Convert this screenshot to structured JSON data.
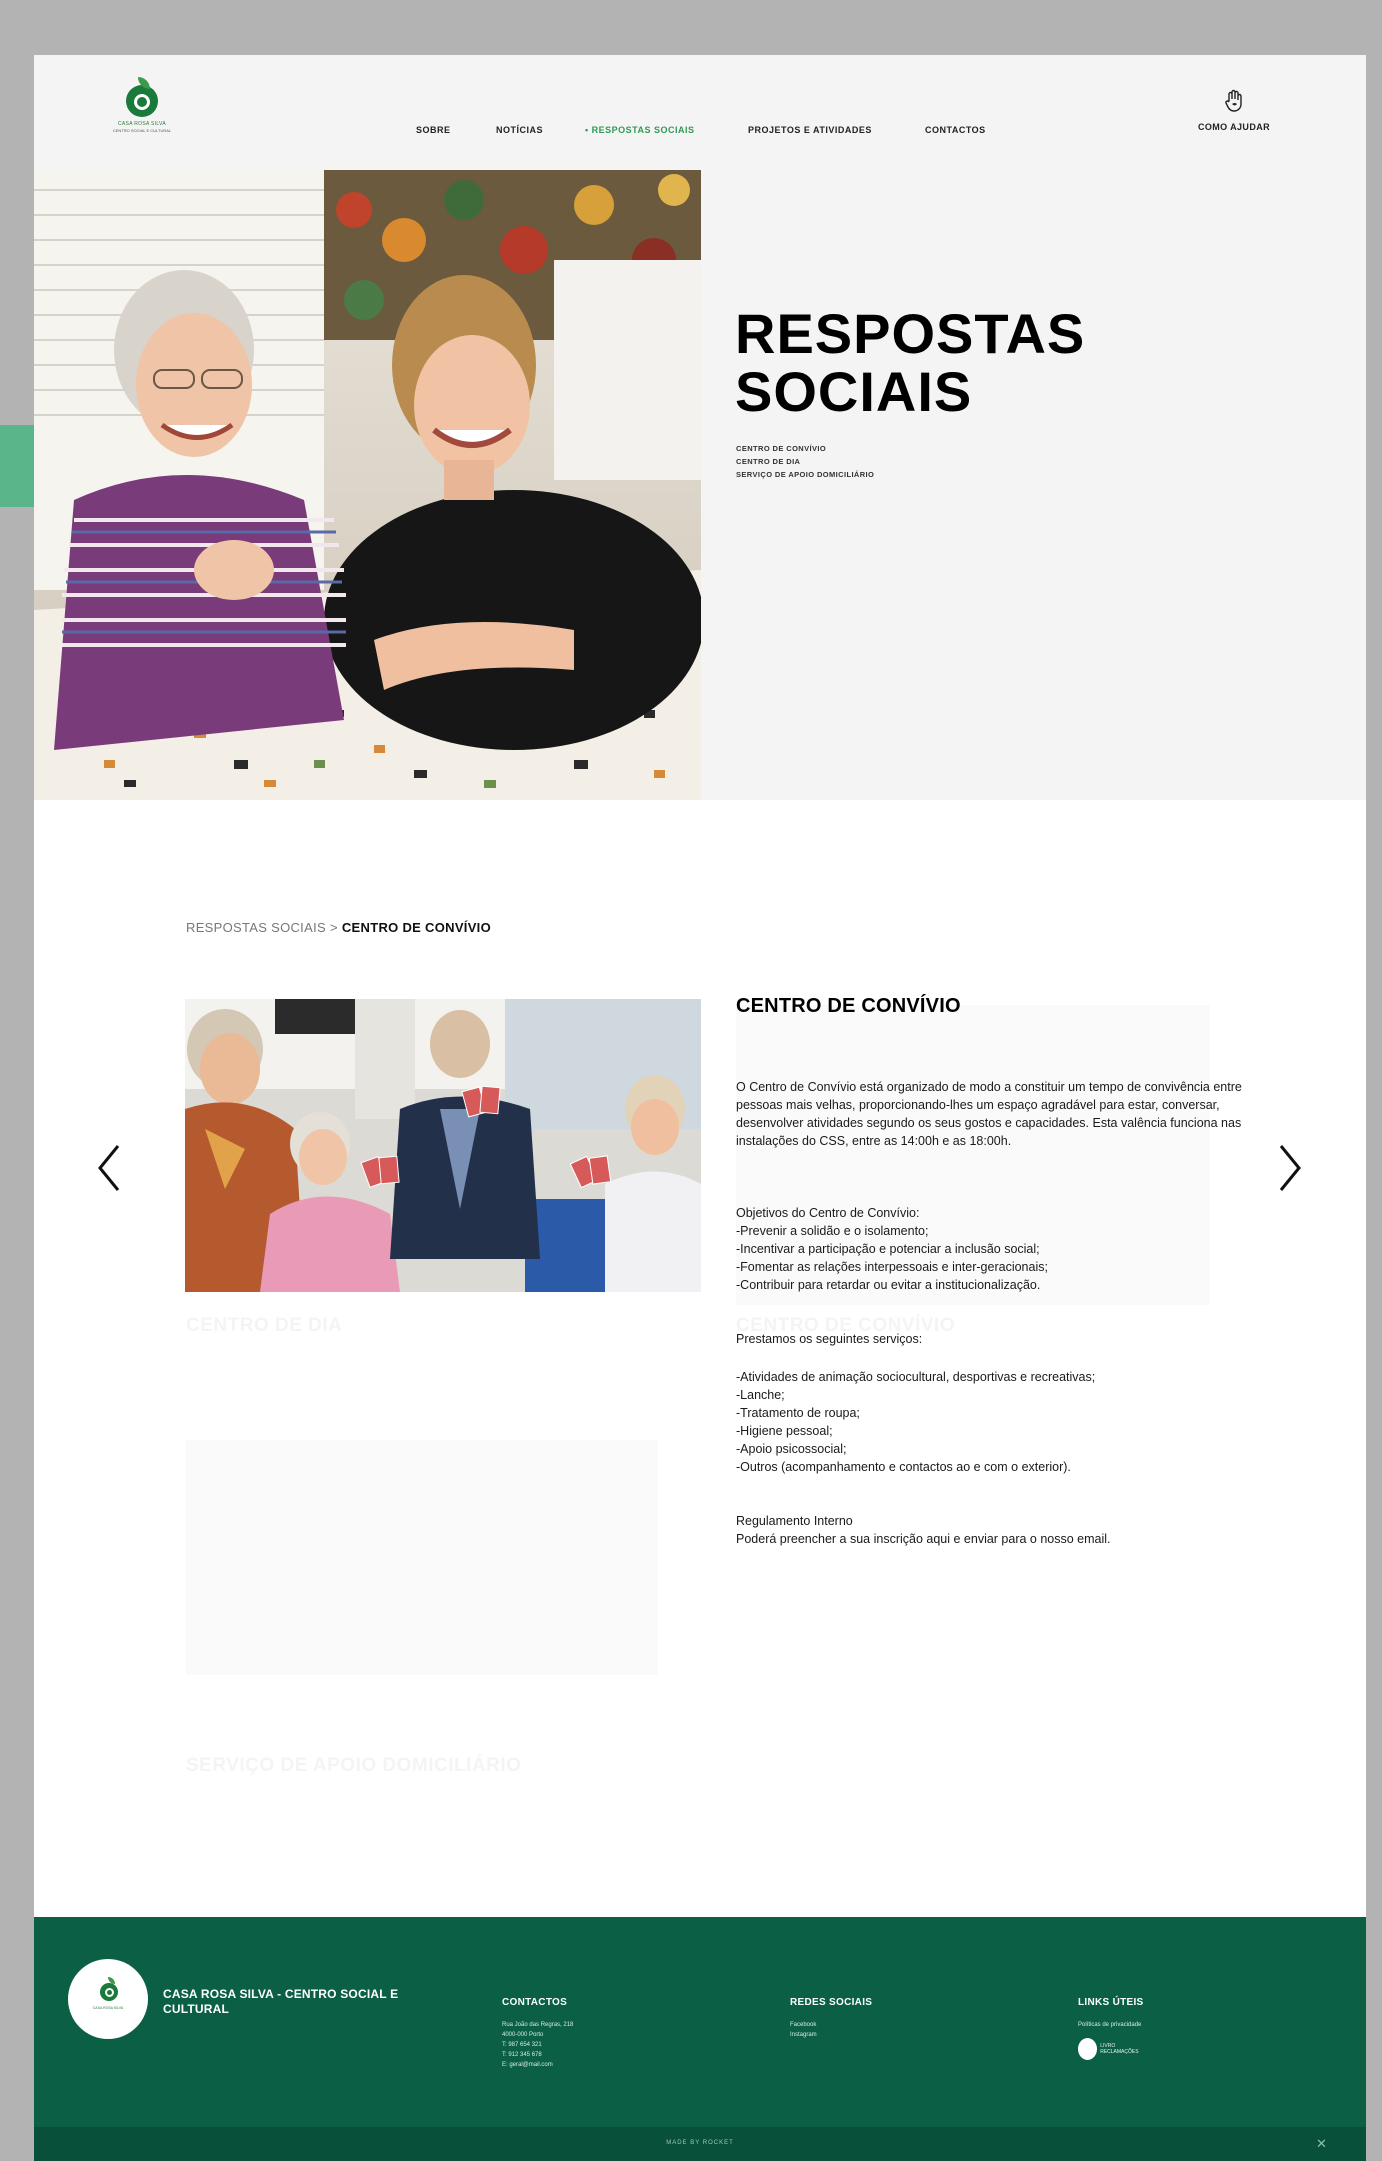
{
  "brand": {
    "logo_text": "CASA ROSA SILVA",
    "logo_sub": "CENTRO SOCIAL E CULTURAL"
  },
  "nav": {
    "items": [
      {
        "label": "SOBRE",
        "active": false
      },
      {
        "label": "NOTÍCIAS",
        "active": false
      },
      {
        "label": "• RESPOSTAS SOCIAIS",
        "active": true
      },
      {
        "label": "PROJETOS E ATIVIDADES",
        "active": false
      },
      {
        "label": "CONTACTOS",
        "active": false
      }
    ],
    "help_label": "COMO AJUDAR"
  },
  "hero": {
    "title_line1": "RESPOSTAS",
    "title_line2": "SOCIAIS",
    "list": [
      "CENTRO DE CONVÍVIO",
      "CENTRO DE DIA",
      "SERVIÇO DE APOIO DOMICILIÁRIO"
    ]
  },
  "breadcrumb": {
    "parent": "RESPOSTAS SOCIAIS",
    "separator": ">",
    "current": "CENTRO DE CONVÍVIO"
  },
  "ghost": {
    "card1": "CENTRO DE DIA",
    "card2": "CENTRO DE CONVÍVIO",
    "card3": "SERVIÇO DE APOIO DOMICILIÁRIO"
  },
  "detail": {
    "title": "CENTRO DE CONVÍVIO",
    "intro": "O Centro de Convívio está organizado de modo a constituir um tempo de convivência entre pessoas mais velhas, proporcionando-lhes um espaço agradável para estar, conversar, desenvolver atividades segundo os seus gostos e capacidades. Esta valência funciona nas instalações do CSS, entre as 14:00h e as 18:00h.",
    "objectives_heading": "Objetivos do Centro de Convívio:",
    "objectives": [
      "-Prevenir a solidão e o isolamento;",
      "-Incentivar a participação e potenciar a inclusão social;",
      "-Fomentar as relações interpessoais e inter-geracionais;",
      "-Contribuir para retardar ou evitar a institucionalização."
    ],
    "services_heading": "Prestamos os seguintes serviços:",
    "services": [
      "-Atividades de animação sociocultural, desportivas e recreativas;",
      "-Lanche;",
      "-Tratamento de roupa;",
      "-Higiene pessoal;",
      "-Apoio psicossocial;",
      "-Outros (acompanhamento e contactos ao e com o exterior)."
    ],
    "regulation": "Regulamento Interno",
    "enroll": "Poderá preencher a sua inscrição aqui e enviar para o nosso email."
  },
  "footer": {
    "logo_text": "CASA ROSA SILVA",
    "org_name": "CASA ROSA SILVA - CENTRO SOCIAL E CULTURAL",
    "contacts_heading": "CONTACTOS",
    "contacts": [
      "Rua João das Regras, 218",
      "4000-000 Porto",
      "T: 987 654 321",
      "T: 912 345 678",
      "E: geral@mail.com"
    ],
    "social_heading": "REDES SOCIAIS",
    "social": [
      "Facebook",
      "Instagram"
    ],
    "links_heading": "LINKS ÚTEIS",
    "links": [
      "Políticas de privacidade"
    ],
    "badge_label": "LIVRO RECLAMAÇÕES",
    "copyright": "MADE BY ROCKET",
    "colors": {
      "footer_bg": "#0b5f45",
      "accent": "#2f9a55"
    }
  }
}
